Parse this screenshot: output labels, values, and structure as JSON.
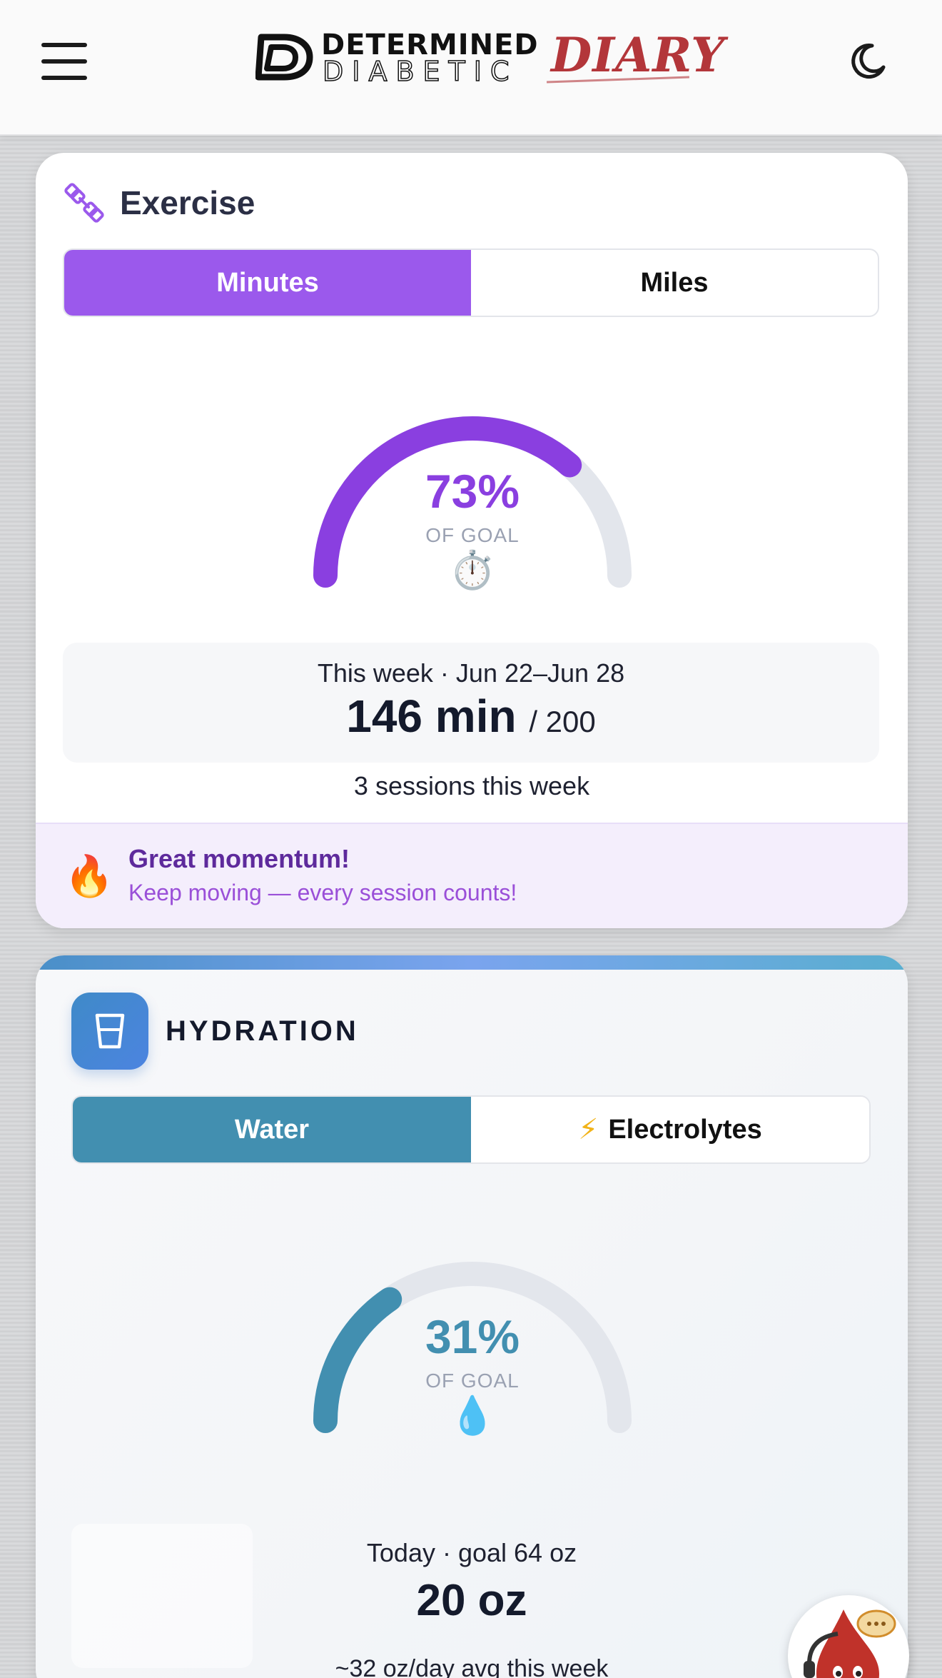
{
  "header": {
    "logo_top": "DETERMINED",
    "logo_bottom": "DIABETIC",
    "logo_diary": "DIARY",
    "menu_icon": "hamburger-icon",
    "theme_icon": "moon-icon"
  },
  "exercise": {
    "title": "Exercise",
    "icon": "dumbbell-icon",
    "tabs": [
      {
        "label": "Minutes",
        "active": true
      },
      {
        "label": "Miles",
        "active": false
      }
    ],
    "gauge": {
      "percent": 73,
      "percent_label": "73%",
      "sub_label": "OF GOAL",
      "emoji": "⏱️",
      "color": "#8a3fe0"
    },
    "week_label": "This week · Jun 22–Jun 28",
    "week_value": "146 min",
    "week_goal": "/ 200",
    "sessions": "3 sessions this week",
    "momentum_title": "Great momentum!",
    "momentum_sub": "Keep moving — every session counts!",
    "momentum_emoji": "🔥"
  },
  "hydration": {
    "title": "HYDRATION",
    "icon": "glass-icon",
    "tabs": [
      {
        "label": "Water",
        "active": true
      },
      {
        "label": "Electrolytes",
        "active": false,
        "icon": "⚡"
      }
    ],
    "gauge": {
      "percent": 31,
      "percent_label": "31%",
      "sub_label": "OF GOAL",
      "emoji": "💧",
      "color": "#428fb0"
    },
    "today_label": "Today · goal 64 oz",
    "today_value": "20 oz",
    "avg_text": "~32 oz/day avg this week"
  },
  "colors": {
    "exercise_accent": "#9b59ec",
    "hydration_accent": "#428fb0",
    "track": "#e3e6ec",
    "logo_red": "#b3363a"
  }
}
